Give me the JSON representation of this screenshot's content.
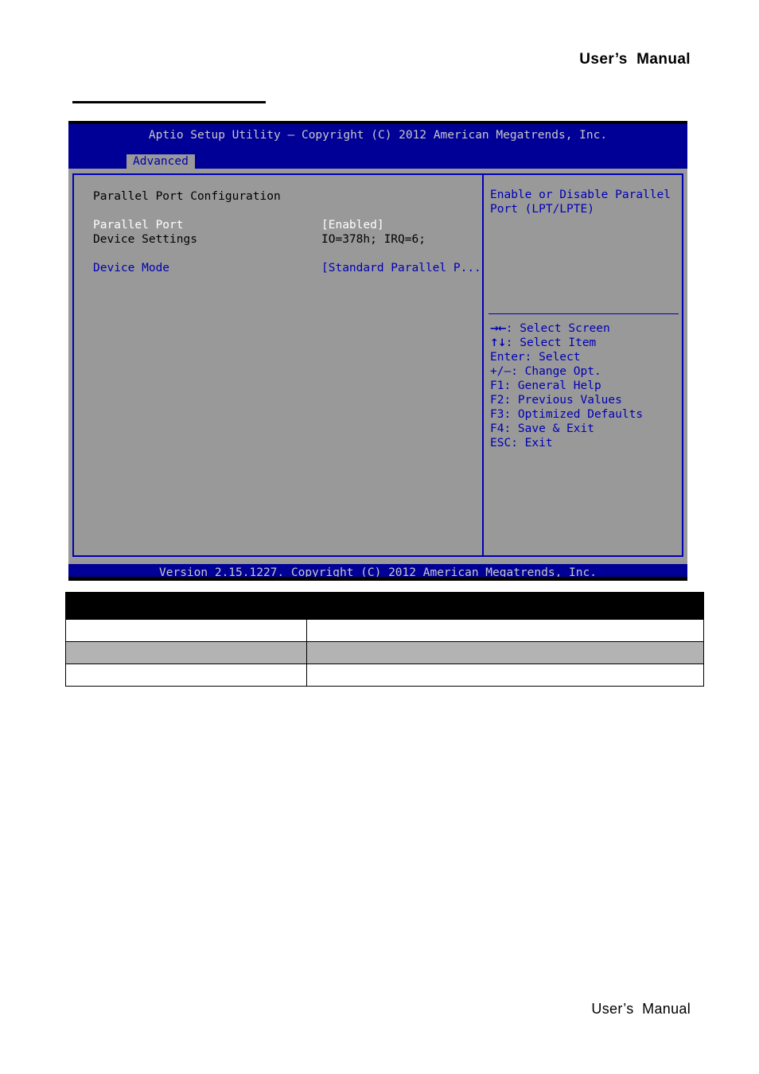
{
  "page": {
    "header_running_head": "User’s  Manual",
    "footer_running_head": "User’s  Manual"
  },
  "bios": {
    "title": "Aptio Setup Utility – Copyright (C) 2012 American Megatrends, Inc.",
    "tabs": [
      {
        "label": "Advanced",
        "active": true
      }
    ],
    "section_heading": "Parallel Port Configuration",
    "settings": [
      {
        "label": "Parallel Port",
        "value": "[Enabled]",
        "label_color": "#ffffff",
        "value_color": "#ffffff"
      },
      {
        "label": "Device Settings",
        "value": "IO=378h; IRQ=6;",
        "label_color": "#000000",
        "value_color": "#000000"
      },
      {
        "label": "Device Mode",
        "value": "[Standard Parallel P...]",
        "label_color": "#0000b4",
        "value_color": "#0000b4"
      }
    ],
    "help": {
      "line1": "Enable or Disable Parallel",
      "line2": "Port (LPT/LPTE)"
    },
    "key_legend": [
      {
        "glyph": "→←",
        "text": ": Select Screen"
      },
      {
        "glyph": "↑↓",
        "text": ": Select Item"
      },
      {
        "glyph": "",
        "text": "Enter: Select"
      },
      {
        "glyph": "",
        "text": "+/–: Change Opt."
      },
      {
        "glyph": "",
        "text": "F1: General Help"
      },
      {
        "glyph": "",
        "text": "F2: Previous Values"
      },
      {
        "glyph": "",
        "text": "F3: Optimized Defaults"
      },
      {
        "glyph": "",
        "text": "F4: Save & Exit"
      },
      {
        "glyph": "",
        "text": "ESC: Exit"
      }
    ],
    "version_bar": "Version 2.15.1227. Copyright (C) 2012 American Megatrends, Inc.",
    "colors": {
      "title_bar": "#000096",
      "body": "#999999",
      "frame_border": "#0000b4",
      "accent_blue": "#0000b4",
      "title_text": "#c8c8c8"
    }
  },
  "spec_table": {
    "header": {
      "col_a": "",
      "col_b": ""
    },
    "rows": [
      {
        "col_a": "",
        "col_b": "",
        "shaded": false
      },
      {
        "col_a": "",
        "col_b": "",
        "shaded": true
      },
      {
        "col_a": "",
        "col_b": "",
        "shaded": false
      }
    ]
  }
}
